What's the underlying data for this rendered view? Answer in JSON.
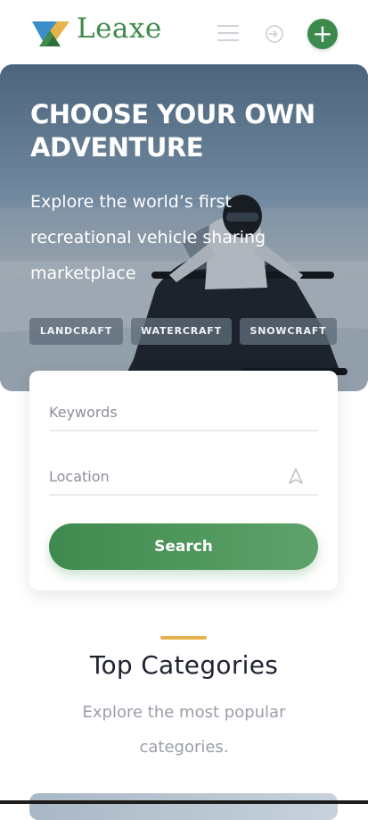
{
  "brand": {
    "name": "Leaxe"
  },
  "header": {
    "add_symbol": "+"
  },
  "hero": {
    "title": "CHOOSE YOUR OWN\nADVENTURE",
    "subtitle": "Explore the world’s first\nrecreational vehicle sharing\nmarketplace",
    "chips": [
      "LANDCRAFT",
      "WATERCRAFT",
      "SNOWCRAFT"
    ]
  },
  "search": {
    "keywords_placeholder": "Keywords",
    "location_placeholder": "Location",
    "button_label": "Search"
  },
  "categories": {
    "title": "Top Categories",
    "subtitle": "Explore the most popular categories."
  },
  "colors": {
    "brand_green": "#3c8a4e",
    "accent_gold": "#e8b04a",
    "chip_bg": "#5f6c7a"
  },
  "icons": {
    "menu": "hamburger-icon",
    "login": "login-icon",
    "add": "plus-icon",
    "location": "location-arrow-icon"
  }
}
